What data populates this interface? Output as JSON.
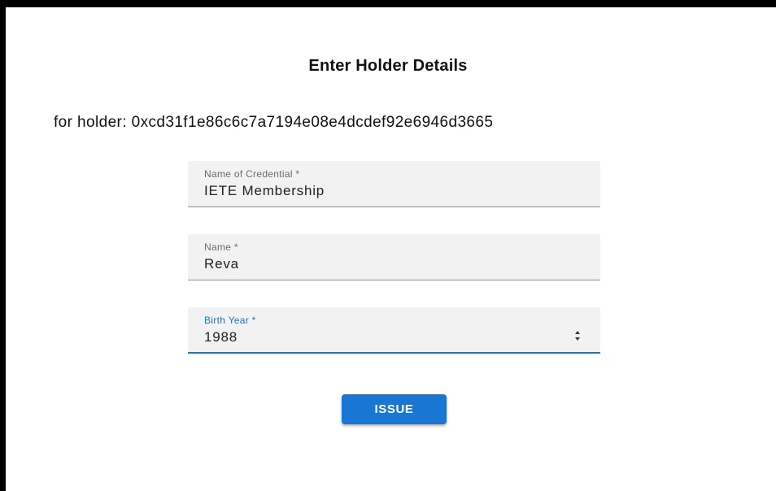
{
  "page": {
    "title": "Enter Holder Details",
    "holder_line": "for holder: 0xcd31f1e86c6c7a7194e08e4dcdef92e6946d3665"
  },
  "form": {
    "credential_name": {
      "label": "Name of Credential *",
      "value": "IETE Membership"
    },
    "name": {
      "label": "Name *",
      "value": "Reva"
    },
    "birth_year": {
      "label": "Birth Year *",
      "value": "1988"
    },
    "issue_button": "ISSUE"
  },
  "colors": {
    "accent": "#1976d2",
    "field_background": "#f2f2f2"
  },
  "icons": {
    "stepper": "up-down-stepper-icon"
  }
}
